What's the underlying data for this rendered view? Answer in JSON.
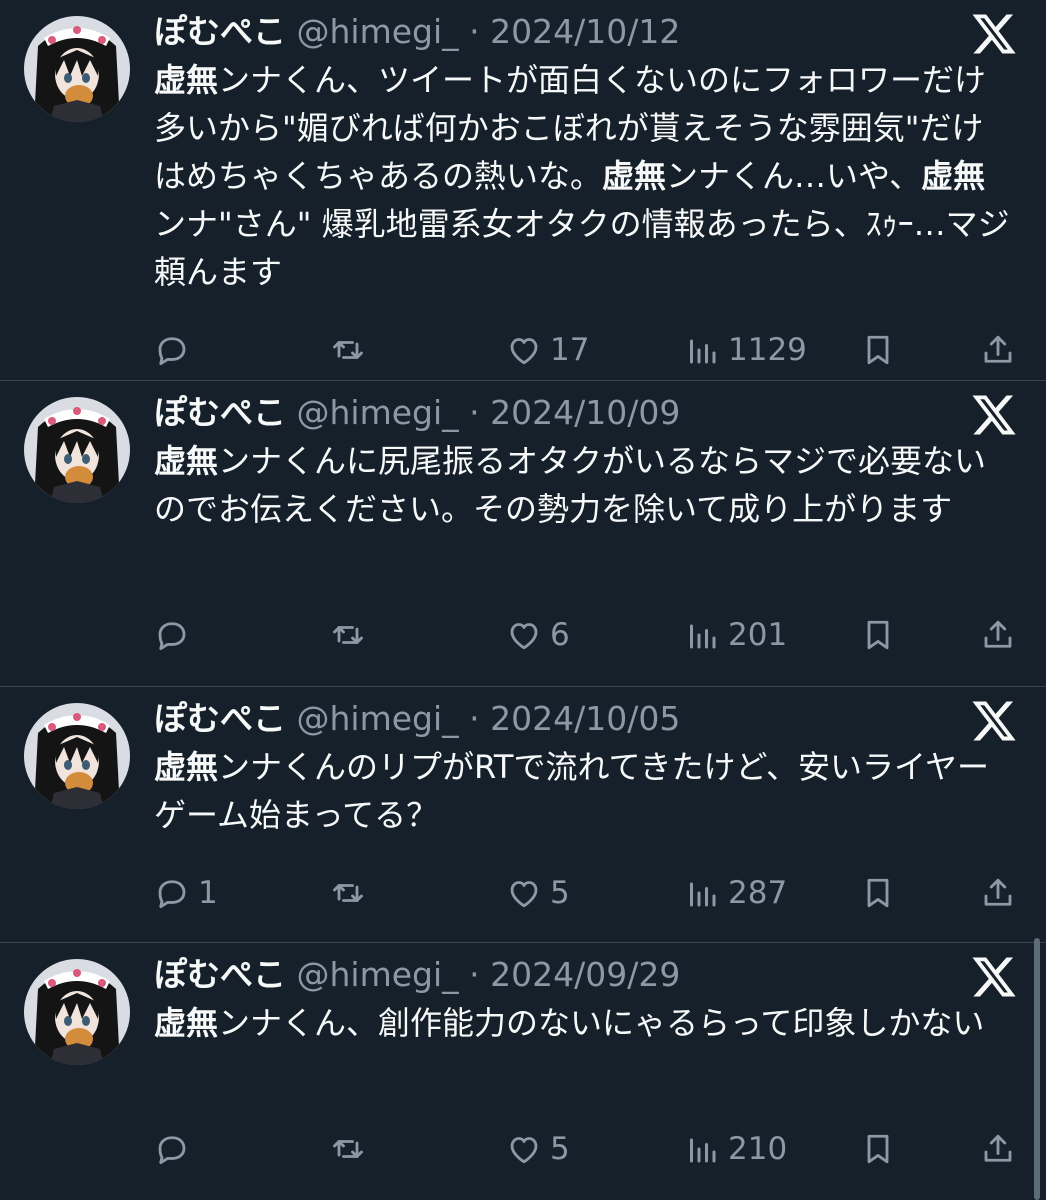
{
  "theme": {
    "background": "#15202b",
    "text": "#f7f9f9",
    "secondary": "#8b98a5",
    "divider": "#38444d"
  },
  "tweets": [
    {
      "author": "ぽむぺこ",
      "handle": "@himegi_",
      "sep": "·",
      "date": "2024/10/12",
      "text_segments": [
        {
          "t": "虚無",
          "b": true
        },
        {
          "t": "ンナくん、ツイートが面白くないのにフォロワーだけ多いから\"媚びれば何かおこぼれが貰えそうな雰囲気\"だけはめちゃくちゃあるの熱いな。",
          "b": false
        },
        {
          "t": "虚無",
          "b": true
        },
        {
          "t": "ンナくん…いや、",
          "b": false
        },
        {
          "t": "虚無",
          "b": true
        },
        {
          "t": "ンナ\"さん\" 爆乳地雷系女オタクの情報あったら、ｽｩｰ…マジ頼んます",
          "b": false
        }
      ],
      "reply_count": "",
      "like_count": "17",
      "view_count": "1129"
    },
    {
      "author": "ぽむぺこ",
      "handle": "@himegi_",
      "sep": "·",
      "date": "2024/10/09",
      "text_segments": [
        {
          "t": "虚無",
          "b": true
        },
        {
          "t": "ンナくんに尻尾振るオタクがいるならマジで必要ないのでお伝えください。その勢力を除いて成り上がります",
          "b": false
        }
      ],
      "reply_count": "",
      "like_count": "6",
      "view_count": "201"
    },
    {
      "author": "ぽむぺこ",
      "handle": "@himegi_",
      "sep": "·",
      "date": "2024/10/05",
      "text_segments": [
        {
          "t": "虚無",
          "b": true
        },
        {
          "t": "ンナくんのリプがRTで流れてきたけど、安いライヤーゲーム始まってる？",
          "b": false
        }
      ],
      "reply_count": "1",
      "like_count": "5",
      "view_count": "287"
    },
    {
      "author": "ぽむぺこ",
      "handle": "@himegi_",
      "sep": "·",
      "date": "2024/09/29",
      "text_segments": [
        {
          "t": "虚無",
          "b": true
        },
        {
          "t": "ンナくん、創作能力のないにゃるらって印象しかない",
          "b": false
        }
      ],
      "reply_count": "",
      "like_count": "5",
      "view_count": "210"
    }
  ],
  "icons": {
    "brand": "x-logo-icon",
    "reply": "reply-icon",
    "retweet": "retweet-icon",
    "like": "heart-icon",
    "views": "views-icon",
    "bookmark": "bookmark-icon",
    "share": "share-icon"
  }
}
